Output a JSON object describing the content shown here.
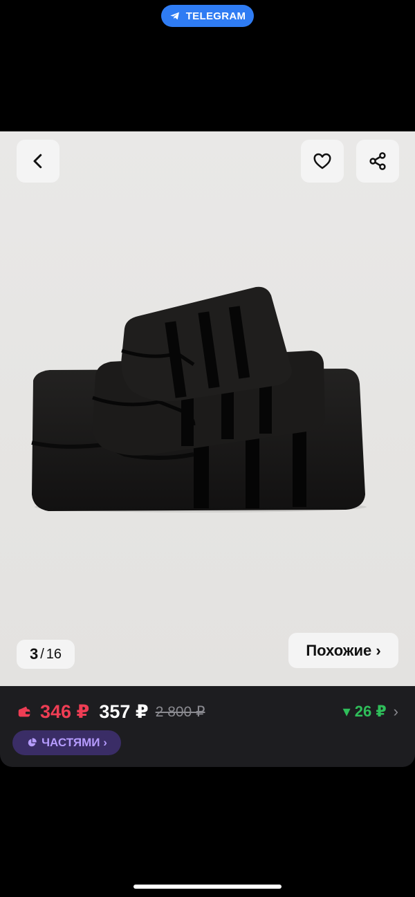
{
  "top_badge": {
    "label": "TELEGRAM",
    "icon": "telegram-icon"
  },
  "gallery": {
    "image": "black-towel-set",
    "current": "3",
    "separator": "/",
    "total": "16",
    "similar_label": "Похожие ›",
    "buttons": {
      "back": "chevron-left-icon",
      "favorite": "heart-icon",
      "share": "share-icon"
    }
  },
  "pricing": {
    "card_price": "346 ₽",
    "price": "357 ₽",
    "old_price": "2 800 ₽",
    "price_drop": "▾ 26 ₽",
    "chevron": "›",
    "installments_label": "ЧАСТЯМИ ›",
    "colors": {
      "card": "#ee3d54",
      "drop": "#2fbe5a",
      "installments": "#b69cff"
    }
  }
}
